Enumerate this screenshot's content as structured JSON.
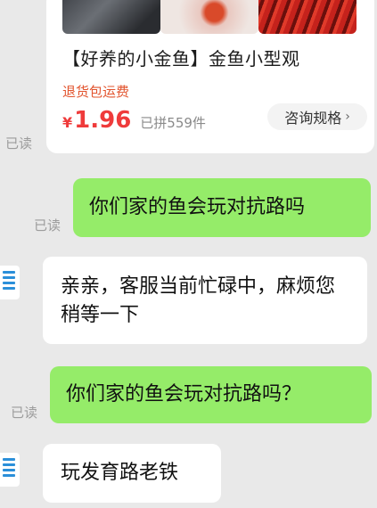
{
  "product_card": {
    "title": "【好养的小金鱼】金鱼小型观",
    "tag": "退货包运费",
    "price_symbol": "¥",
    "price": "1.96",
    "sold": "已拼559件",
    "consult_label": "咨询规格"
  },
  "read_label": "已读",
  "messages": [
    {
      "side": "right",
      "text": "你们家的鱼会玩对抗路吗"
    },
    {
      "side": "left",
      "text": "亲亲，客服当前忙碌中，麻烦您稍等一下"
    },
    {
      "side": "right",
      "text": "你们家的鱼会玩对抗路吗？"
    },
    {
      "side": "left",
      "text": "玩发育路老铁"
    }
  ],
  "colors": {
    "outgoing_bubble": "#95ec69",
    "incoming_bubble": "#ffffff",
    "price": "#ef3b3b",
    "tag": "#e2542e",
    "background": "#e9e9e9"
  },
  "icons": {
    "avatar": "customer-service-avatar-icon",
    "chevron": "chevron-right-icon"
  }
}
